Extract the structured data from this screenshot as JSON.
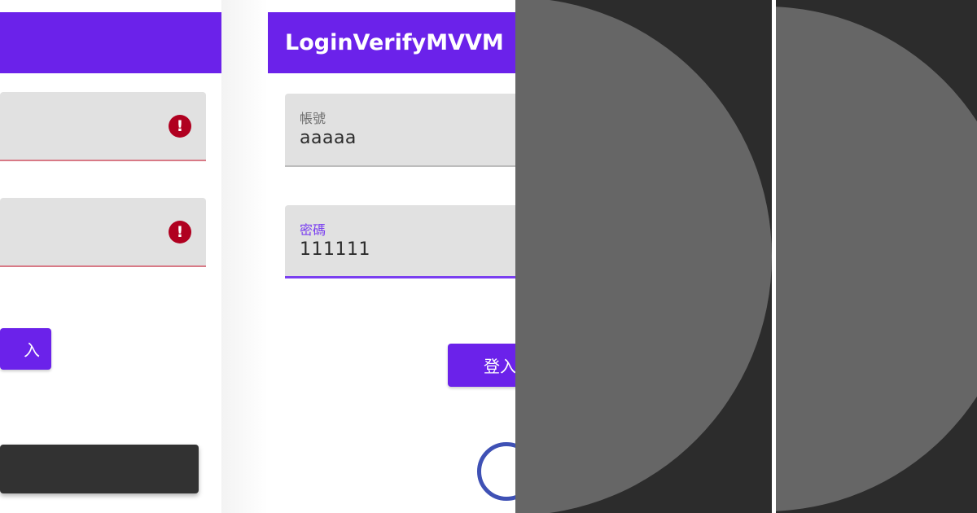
{
  "app": {
    "title": "LoginVerifyMVVM"
  },
  "left_screen": {
    "field_1": {
      "error_icon": "!"
    },
    "field_2": {
      "error_icon": "!"
    },
    "login_button_label": "入"
  },
  "right_screen": {
    "account_field": {
      "label": "帳號",
      "value": "aaaaa"
    },
    "password_field": {
      "label": "密碼",
      "value": "111111"
    },
    "login_button_label": "登入"
  },
  "colors": {
    "primary": "#6b22ea",
    "error": "#b00020",
    "focused_label": "#7a3ff0",
    "spinner": "#3f51b5",
    "snackbar": "#323232",
    "overlay_dark": "#2c2c2c",
    "overlay_disc": "#666666"
  },
  "icons": {
    "error": "error-exclamation-icon",
    "progress": "progress-spinner-icon"
  }
}
